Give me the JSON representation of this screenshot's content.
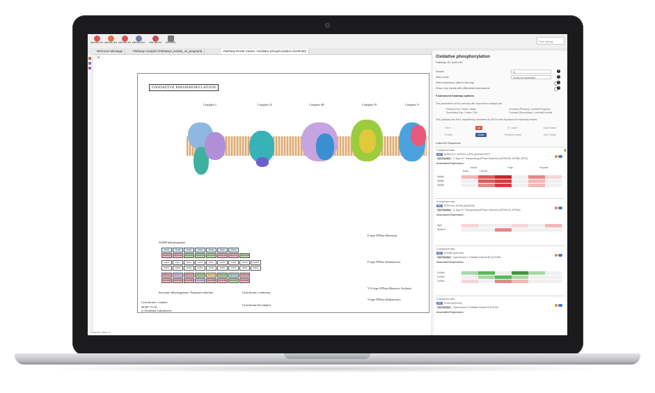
{
  "toolbar": {
    "tools": [
      {
        "label": "pathway search",
        "color": "#d9534f"
      },
      {
        "label": "pathway analysis",
        "color": "#e07a3a"
      },
      {
        "label": "pathway analysis",
        "color": "#d9534f"
      },
      {
        "label": "pathway analysis",
        "color": "#6b7fb0"
      },
      {
        "label": "meta generation",
        "color": "#c75050"
      },
      {
        "label": "workflows",
        "color": "#777777"
      }
    ],
    "search_placeholder": "Start typing"
  },
  "tabs": [
    "Welcome Message",
    "Pathway Analysis (Pathways_lactate_vs_pregnant)",
    "Pathway Result Viewer: Oxidative phosphorylation (ko00190)"
  ],
  "map": {
    "title": "OXIDATIVE PHOSPHORYLATION",
    "complexes": [
      "Complex I",
      "Complex II",
      "Complex III",
      "Complex IV",
      "Complex V"
    ],
    "labels": {
      "nadh": "NADH dehydrogenase",
      "succinate": "Succinate dehydrogenase / Fumarate reductase",
      "cyt_c_reductase": "Cytochrome c reductase",
      "cyt_c_oxidase": "Cytochrome c oxidase",
      "cyt_bd": "Cytochrome bd complex",
      "f_type": "F-type ATPase (Bacteria)",
      "v_type": "V/A-type ATPase (Bacteria, Archaea)",
      "f_type_euk": "F-type ATPase (Eukaryotes)",
      "v_type_euk": "V-type ATPase (Eukaryotes)",
      "footer1": "00190 7/1/16",
      "footer2": "(c) Kanehisa Laboratories"
    },
    "grid_rows": [
      {
        "prefix": "E",
        "cells": [
          "NuoA",
          "NuoB",
          "NuoC",
          "NuoD",
          "NuoE",
          "NuoF",
          "NuoG"
        ]
      },
      {
        "prefix": "E",
        "cells": [
          "NDUFS1",
          "NDUFS2",
          "NDUFS3",
          "NDUFS4",
          "NDUFS5",
          "NDUFS6",
          "NDUFS7",
          "NDUFS8"
        ]
      },
      {
        "prefix": "F",
        "cells": [
          "NuoH",
          "NuoI",
          "NuoJ",
          "NuoK",
          "NuoL",
          "NuoM",
          "NuoN",
          "NuoL2",
          "NuoM2"
        ]
      },
      {
        "prefix": "F",
        "cells": [
          "Ndh1",
          "Ndh2",
          "Ndh3",
          "Ndh4",
          "Ndh5",
          "Ndh6",
          "Ndh7",
          "NdhF",
          "NdhG"
        ]
      },
      {
        "prefix": "E",
        "cells": [
          "NDUFA1",
          "NDUFA2",
          "NDUFA3",
          "NDUFA4",
          "NDUFA5",
          "NDUFA6",
          "NDUFA7",
          "NDUFA8"
        ]
      },
      {
        "prefix": "E",
        "cells": [
          "NDUFB1",
          "NDUFB2",
          "NDUFB3",
          "NDUFB4",
          "NDUFB5",
          "NDUFB6",
          "NDUFB7",
          "NDUFB8"
        ]
      }
    ]
  },
  "panel": {
    "title": "Oxidative phosphorylation",
    "pathway_id": "Pathway ID: ko00190",
    "options": [
      {
        "label": "Search",
        "value": "Q"
      },
      {
        "label": "View mode",
        "value": "Group by expression"
      },
      {
        "label": "Paint expression data in the map",
        "value": ""
      },
      {
        "label": "Show only results with differential expressions",
        "value": ""
      }
    ],
    "advanced": "Advanced heatmap options",
    "para1": "The parameters of the pathway diff. expression analysis are:",
    "para2a": "Primary Exp. Factor: Stage",
    "para2b": "Secondary Exp. Factor: Cell",
    "para2c": "Contrast (Primary): Lactate/Pregnant",
    "para2d": "Contrast (Secondary): Luminal/Luminal",
    "para3": "This pathway has thus, may/directly annotated by DEGs and displayed the following results:",
    "legend": [
      {
        "label": "Up",
        "color": "#d9534f"
      },
      {
        "label": "Under",
        "color": "#3a5ba0"
      }
    ],
    "legend_links": [
      "Gene",
      "Protein",
      "FC value",
      "Problem solved",
      "Data Solver",
      "DEG Solver"
    ],
    "linked": "Linked KO Sequences",
    "genes": [
      {
        "count": "3 sequence sets",
        "ids": "ATP6V1C1, ATP6V1, ATP6 (ko00190 ATP)",
        "func": "F-Type H+ Transporting ATPase Subunit A (ATP6V1B, ATP5B, ATP5)",
        "rows": [
          "Atp5g1",
          "Atp5g2",
          "Atp5g3"
        ]
      },
      {
        "count": "3 sequence sets",
        "ids": "ATP6V1A, ATP6A (ko00190)",
        "func": "V-Type H+ Transporting ATPase Subunit A (ATP6V1A, ATP6A)",
        "rows": [
          "Atp6",
          "Atp6v1a"
        ]
      },
      {
        "count": "3 sequence sets",
        "ids": "COX5B (ko00190)",
        "func": "Cytochrome C Oxidase Subunit 5b (COX5b)",
        "rows": [
          "Cox5a1",
          "Cox5a2",
          "Cox5b1"
        ]
      },
      {
        "count": "3 sequence sets",
        "ids": "COX6 (ko00190)",
        "func": "Cytochrome C Oxidase Subunit 6 (COX6)",
        "rows": []
      }
    ],
    "heat_header": {
      "groups": [
        "Lactate",
        "Virgin",
        "Pregnant"
      ],
      "subs": [
        "Basal",
        "Luminal"
      ]
    },
    "expr_label": "Associated Expression:"
  },
  "status": "Omicsbox Beta 3.1"
}
